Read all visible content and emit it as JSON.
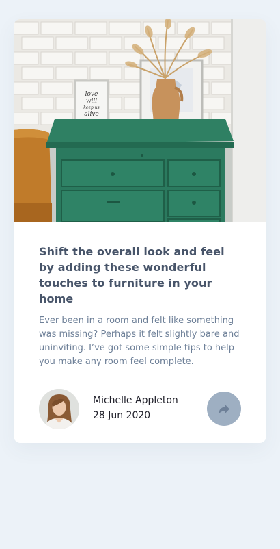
{
  "article": {
    "image_alt": "Green dresser with vase and framed print",
    "print_text": "love will keep us alive",
    "title": "Shift the overall look and feel by adding these wonderful touches to furniture in your home",
    "excerpt": "Ever been in a room and felt like something was missing? Perhaps it felt slightly bare and uninviting. I’ve got some simple tips to help you make any room feel complete."
  },
  "author": {
    "name": "Michelle Appleton",
    "date": "28 Jun 2020"
  },
  "share": {
    "icon": "share-icon"
  },
  "colors": {
    "background": "#ecf2f8",
    "title": "#48556a",
    "text": "#6e8098",
    "share_button": "#9eafc2",
    "dresser": "#2d7a60"
  }
}
